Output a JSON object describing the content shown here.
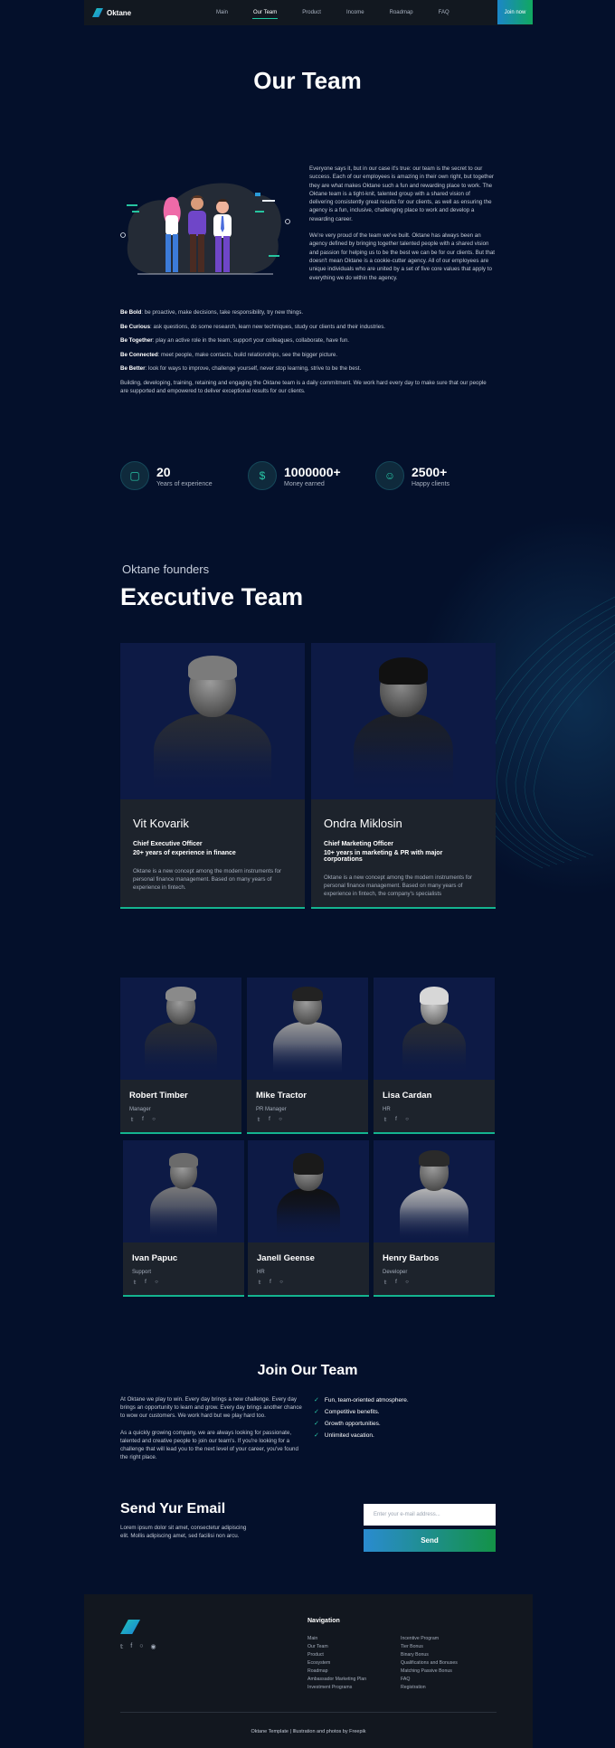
{
  "nav": {
    "brand": "Oktane",
    "links": [
      "Main",
      "Our Team",
      "Product",
      "Income",
      "Roadmap",
      "FAQ"
    ],
    "active": "Our Team",
    "join_label": "Join now"
  },
  "hero": {
    "title": "Our Team",
    "intro_p1": "Everyone says it, but in our case it's true: our team is the secret to our success. Each of our employees is amazing in their own right, but together they are what makes Oktane such a fun and rewarding place to work. The Oktane team is a tight-knit, talented group with a shared vision of delivering consistently great results for our clients, as well as ensuring the agency is a fun, inclusive, challenging place to work and develop a rewarding career.",
    "intro_p2": "We're very proud of the team we've built. Oktane has always been an agency defined by bringing together talented people with a shared vision and passion for helping us to be the best we can be for our clients. But that doesn't mean Oktane is a cookie-cutter agency. All of our employees are unique individuals who are united by a set of five core values that apply to everything we do within the agency."
  },
  "values": [
    {
      "title": "Be Bold",
      "text": ": be proactive, make decisions, take responsibility, try new things."
    },
    {
      "title": "Be Curious",
      "text": ": ask questions, do some research, learn new techniques, study our clients and their industries."
    },
    {
      "title": "Be Together",
      "text": ": play an active role in the team, support your colleagues, collaborate, have fun."
    },
    {
      "title": "Be Connected",
      "text": ": meet people, make contacts, build relationships, see the bigger picture."
    },
    {
      "title": "Be Better",
      "text": ": look for ways to improve, challenge yourself, never stop learning, strive to be the best."
    }
  ],
  "values_closing": "Building, developing, training, retaining and engaging the Oktane team is a daily commitment. We work hard every day to make sure that our people are supported and empowered to deliver exceptional results for our clients.",
  "stats": [
    {
      "value": "20",
      "label": "Years of experience",
      "icon": "calendar-icon"
    },
    {
      "value": "1000000+",
      "label": "Money earned",
      "icon": "money-bag-icon"
    },
    {
      "value": "2500+",
      "label": "Happy clients",
      "icon": "smile-icon"
    }
  ],
  "executive": {
    "kicker": "Oktane founders",
    "title": "Executive Team",
    "members": [
      {
        "name": "Vit Kovarik",
        "role": "Chief Executive Officer",
        "experience": "20+ years of experience in finance",
        "description": "Oktane is a new concept among the modern instruments for personal finance management. Based on many years of experience in fintech."
      },
      {
        "name": "Ondra Miklosin",
        "role": "Chief Marketing Officer",
        "experience": "10+ years in marketing & PR with major corporations",
        "description": "Oktane is a new concept among the modern instruments for personal finance management. Based on many years of experience in fintech, the company's specialists"
      }
    ]
  },
  "team": [
    {
      "name": "Robert Timber",
      "role": "Manager"
    },
    {
      "name": "Mike Tractor",
      "role": "PR Manager"
    },
    {
      "name": "Lisa Cardan",
      "role": "HR"
    },
    {
      "name": "Ivan Papuc",
      "role": "Support"
    },
    {
      "name": "Janell Geense",
      "role": "HR"
    },
    {
      "name": "Henry Barbos",
      "role": "Developer"
    }
  ],
  "join": {
    "title": "Join Our Team",
    "p1": "At Oktane we play to win. Every day brings a new challenge. Every day brings an opportunity to learn and grow. Every day brings another chance to wow our customers. We work hard but we play hard too.",
    "p2": "As a quickly growing company, we are always looking for passionate, talented and creative people to join our team's. If you're looking for a challenge that will lead you to the next level of your career, you've found the right place.",
    "perks": [
      "Fun, team-oriented atmosphere.",
      "Competitive benefits.",
      "Growth opportunities.",
      "Unlimited vacation."
    ]
  },
  "email": {
    "title": "Send Yur Email",
    "text": "Lorem ipsum dolor sit amet, consectetur adipiscing elit. Mollis adipiscing amet, sed facilisi non arcu.",
    "placeholder": "Enter your e-mail address...",
    "button": "Send"
  },
  "footer": {
    "nav_title": "Navigation",
    "col1": [
      "Main",
      "Our Team",
      "Product",
      "Ecosystem",
      "Roadmap",
      "Ambassador Marketing Plan",
      "Investment Programs"
    ],
    "col2": [
      "Incentive Program",
      "Tier Bonus",
      "Binary Bonus",
      "Qualifications and Bonuses",
      "Matching Passive Bonus",
      "FAQ",
      "Registration"
    ],
    "copyright": "Oktane Template  |  Illustration and photos by Freepik"
  }
}
